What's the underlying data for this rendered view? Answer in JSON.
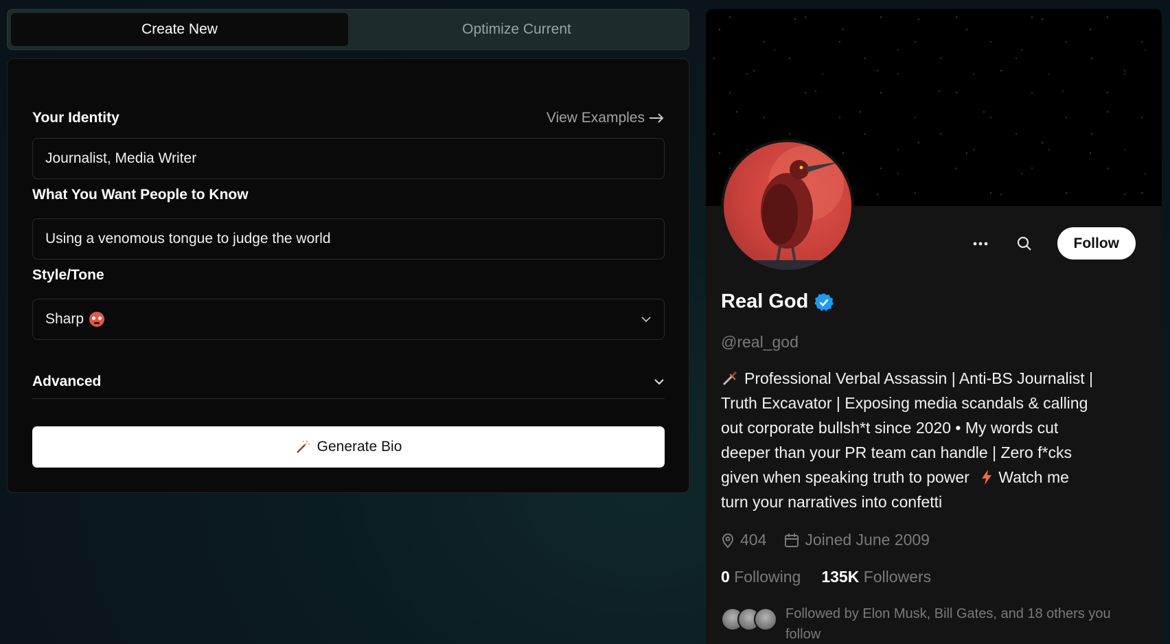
{
  "tabs": {
    "create_new": "Create New",
    "optimize_current": "Optimize Current"
  },
  "form": {
    "identity_label": "Your Identity",
    "view_examples": "View Examples",
    "identity_value": "Journalist, Media Writer",
    "know_label": "What You Want People to Know",
    "know_value": "Using a venomous tongue to judge the world",
    "style_label": "Style/Tone",
    "style_value": "Sharp",
    "advanced_label": "Advanced",
    "generate_label": "Generate Bio"
  },
  "profile": {
    "name": "Real God",
    "handle": "@real_god",
    "follow_label": "Follow",
    "bio_lines": [
      "Professional Verbal Assassin | Anti-BS Journalist |",
      "Truth Excavator | Exposing media scandals & calling",
      "out corporate bullsh*t since 2020 • My words cut",
      "deeper than your PR team can handle | Zero f*cks",
      "given when speaking truth to power",
      "Watch me",
      "turn your narratives into confetti"
    ],
    "location": "404",
    "joined": "Joined June 2009",
    "following_count": "0",
    "following_label": "Following",
    "followers_count": "135K",
    "followers_label": "Followers",
    "followed_by": "Followed by Elon Musk, Bill Gates, and 18 others you follow"
  },
  "colors": {
    "verified": "#1d9bf0",
    "background": "#0b1c21",
    "card": "#0a0a0a",
    "profile_bg": "#141414"
  }
}
